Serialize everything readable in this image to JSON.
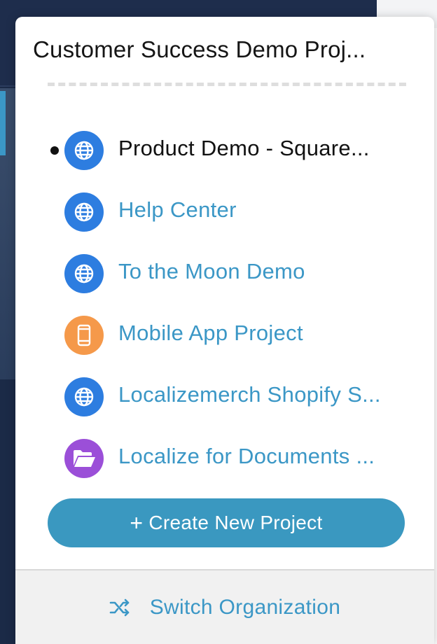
{
  "organization": {
    "title": "Customer Success Demo Proj..."
  },
  "projects": [
    {
      "label": "Product Demo - Square...",
      "icon": "globe-icon",
      "active": true
    },
    {
      "label": "Help Center",
      "icon": "globe-icon",
      "active": false
    },
    {
      "label": "To the Moon Demo",
      "icon": "globe-icon",
      "active": false
    },
    {
      "label": "Mobile App Project",
      "icon": "mobile-phone-icon",
      "active": false
    },
    {
      "label": "Localizemerch Shopify S...",
      "icon": "globe-icon",
      "active": false
    },
    {
      "label": "Localize for Documents ...",
      "icon": "folder-open-icon",
      "active": false
    }
  ],
  "actions": {
    "create_symbol": "+",
    "create_label": "Create New Project",
    "switch_label": "Switch Organization",
    "switch_icon": "shuffle-icon"
  },
  "colors": {
    "accent": "#3b97c6",
    "button": "#3a98c0",
    "web_icon": "#2d7de0",
    "mobile_icon": "#f5994a",
    "docs_icon": "#9b4fd8"
  }
}
